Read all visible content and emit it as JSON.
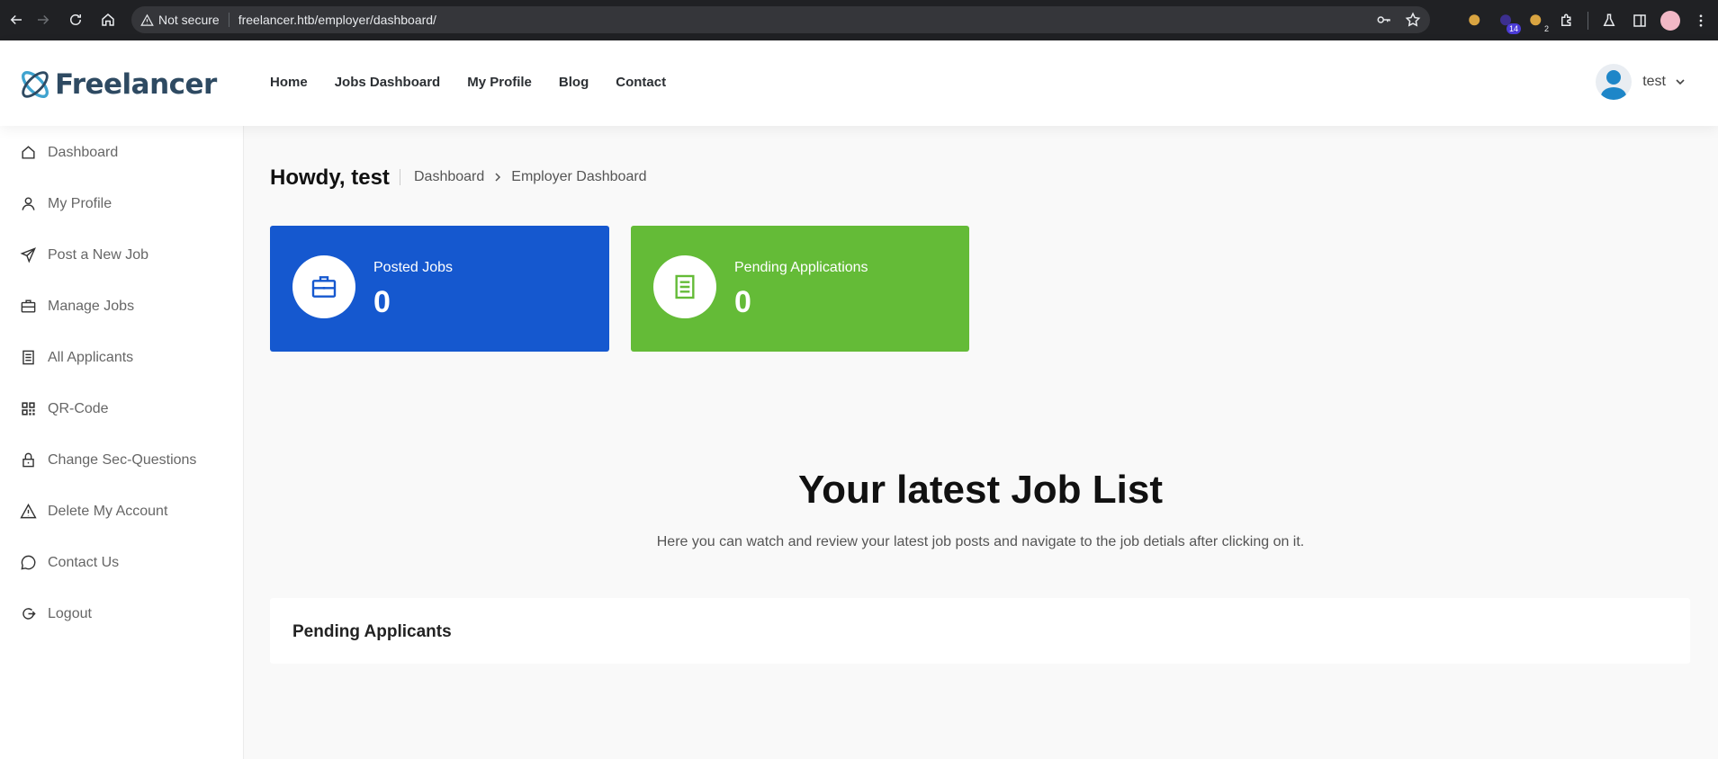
{
  "browser": {
    "security_label": "Not secure",
    "url": "freelancer.htb/employer/dashboard/",
    "extension_badge_1": "14",
    "extension_badge_2": "2"
  },
  "header": {
    "logo_text": "Freelancer",
    "nav": [
      "Home",
      "Jobs Dashboard",
      "My Profile",
      "Blog",
      "Contact"
    ],
    "user_name": "test"
  },
  "sidebar": {
    "items": [
      {
        "label": "Dashboard",
        "icon": "home-icon"
      },
      {
        "label": "My Profile",
        "icon": "user-icon"
      },
      {
        "label": "Post a New Job",
        "icon": "send-icon"
      },
      {
        "label": "Manage Jobs",
        "icon": "briefcase-icon"
      },
      {
        "label": "All Applicants",
        "icon": "document-icon"
      },
      {
        "label": "QR-Code",
        "icon": "qr-code-icon"
      },
      {
        "label": "Change Sec-Questions",
        "icon": "lock-icon"
      },
      {
        "label": "Delete My Account",
        "icon": "warning-icon"
      },
      {
        "label": "Contact Us",
        "icon": "chat-icon"
      },
      {
        "label": "Logout",
        "icon": "logout-icon"
      }
    ]
  },
  "main": {
    "greeting": "Howdy, test",
    "breadcrumb": [
      "Dashboard",
      "Employer Dashboard"
    ],
    "stats": [
      {
        "label": "Posted Jobs",
        "value": "0",
        "color": "#1558cf",
        "icon": "briefcase-icon"
      },
      {
        "label": "Pending Applications",
        "value": "0",
        "color": "#64bb37",
        "icon": "document-icon"
      }
    ],
    "section_title": "Your latest Job List",
    "section_subtitle": "Here you can watch and review your latest job posts and navigate to the job detials after clicking on it.",
    "pending_title": "Pending Applicants"
  }
}
